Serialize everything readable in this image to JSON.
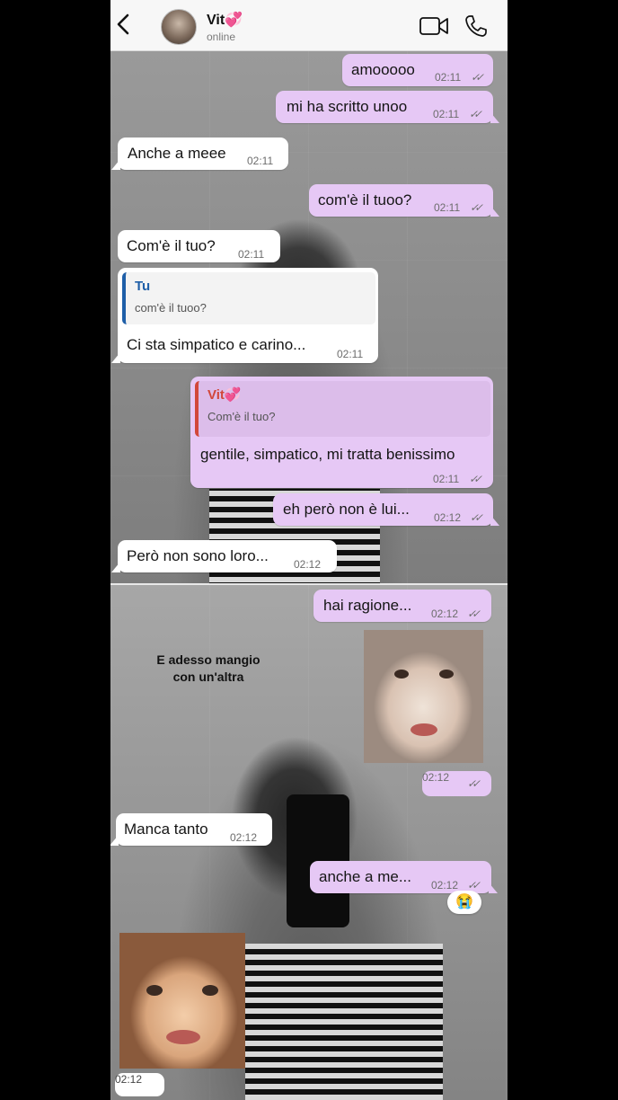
{
  "header": {
    "contact_name": "Vit💞",
    "status": "online"
  },
  "messages": {
    "m1": {
      "text": "amooooo",
      "time": "02:11",
      "ticks": "✓✓"
    },
    "m2": {
      "text": "mi ha scritto unoo",
      "time": "02:11",
      "ticks": "✓✓"
    },
    "m3": {
      "text": "Anche a meee",
      "time": "02:11"
    },
    "m4": {
      "text": "com'è il tuoo?",
      "time": "02:11",
      "ticks": "✓✓"
    },
    "m5": {
      "text": "Com'è il tuo?",
      "time": "02:11"
    },
    "m6": {
      "quote_name": "Tu",
      "quote_text": "com'è il tuoo?",
      "text": "Ci sta simpatico e carino...",
      "time": "02:11"
    },
    "m7": {
      "quote_name": "Vit💞",
      "quote_text": "Com'è il tuo?",
      "text": "gentile, simpatico, mi tratta benissimo",
      "time": "02:11",
      "ticks": "✓✓"
    },
    "m8": {
      "text": "eh però non è lui...",
      "time": "02:12",
      "ticks": "✓✓"
    },
    "m9": {
      "text": "Però non sono loro...",
      "time": "02:12"
    },
    "m10": {
      "text": "hai ragione...",
      "time": "02:12",
      "ticks": "✓✓"
    },
    "m11": {
      "time": "02:12",
      "ticks": "✓✓"
    },
    "m12": {
      "text": "Manca tanto",
      "time": "02:12"
    },
    "m13": {
      "text": "anche a me...",
      "time": "02:12",
      "ticks": "✓✓",
      "reaction": "😭"
    },
    "m14": {
      "time": "02:12"
    }
  },
  "overlay_caption": "E adesso mangio con un'altra",
  "colors": {
    "outgoing": "#e6c8f5",
    "incoming": "#ffffff",
    "quote_tu": "#1f5fa8",
    "quote_vit": "#d2473a"
  }
}
